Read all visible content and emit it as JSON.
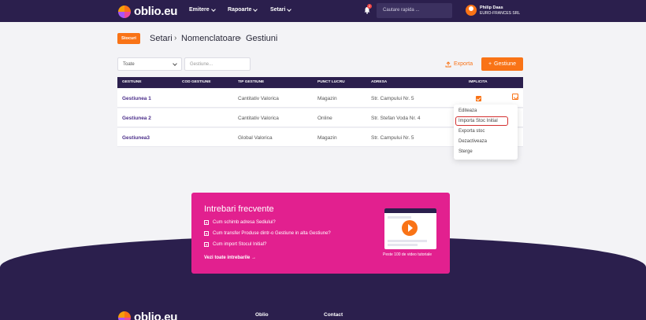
{
  "nav": {
    "brand": "oblio.eu",
    "items": [
      "Emitere",
      "Rapoarte",
      "Setari"
    ],
    "notifications": "2",
    "search_placeholder": "Cautare rapida ...",
    "user_name": "Philip Daas",
    "user_company": "EURO-FRANCES SRL"
  },
  "breadcrumb": {
    "badge": "Stocuri",
    "items": [
      "Setari",
      "Nomenclatoare",
      "Gestiuni"
    ]
  },
  "filters": {
    "select_value": "Toate",
    "search_placeholder": "Gestiune..."
  },
  "actions": {
    "export": "Exporta",
    "add": "Gestiune"
  },
  "table": {
    "headers": [
      "GESTIUNE",
      "COD GESTIUNE",
      "TIP GESTIUNE",
      "PUNCT LUCRU",
      "ADRESA",
      "IMPLICITA"
    ],
    "rows": [
      {
        "name": "Gestiunea 1",
        "code": "",
        "type": "Cantitativ Valorica",
        "punct": "Magazin",
        "adresa": "Str. Campului Nr. 5",
        "implicita": true
      },
      {
        "name": "Gestiunea 2",
        "code": "",
        "type": "Cantitativ Valorica",
        "punct": "Online",
        "adresa": "Str. Stefan Voda Nr. 4",
        "implicita": false
      },
      {
        "name": "Gestiunea3",
        "code": "",
        "type": "Global Valorica",
        "punct": "Magazin",
        "adresa": "Str. Campului Nr. 5",
        "implicita": false
      }
    ]
  },
  "dropdown": {
    "items": [
      "Editeaza",
      "Importa Stoc Initial",
      "Exporta stoc",
      "Dezactiveaza",
      "Sterge"
    ],
    "highlighted_index": 1
  },
  "faq": {
    "title": "Intrebari frecvente",
    "questions": [
      "Cum schimb adresa Sediului?",
      "Cum transfer Produse dintr-o Gestiune in alta Gestiune?",
      "Cum import Stocul Initial?"
    ],
    "more": "Vezi toate intrebarile",
    "video_caption": "Peste 100 de video tutoriale"
  },
  "footer": {
    "links": [
      "Oblio",
      "Contact"
    ]
  },
  "colors": {
    "nav_bg": "#2b1f4d",
    "accent": "#f97316",
    "faq_bg": "#e2208f",
    "highlight": "#d32f2f"
  }
}
